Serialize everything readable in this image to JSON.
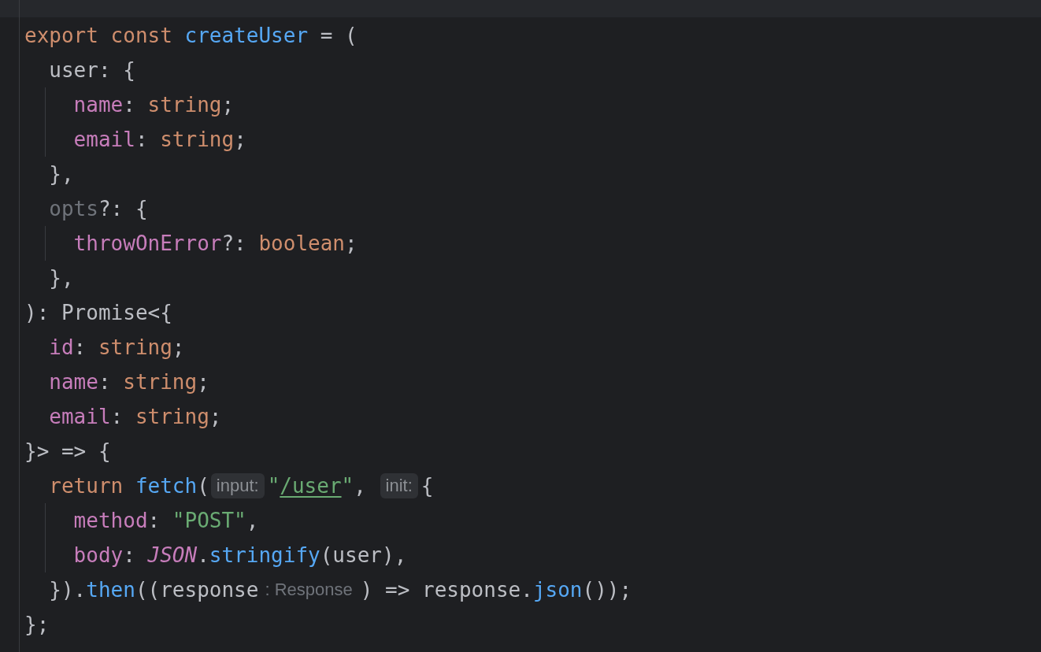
{
  "editor": {
    "lines": [
      {
        "tokens": [
          {
            "kind": "keyword",
            "text": "export const "
          },
          {
            "kind": "function",
            "text": "createUser"
          },
          {
            "kind": "plain",
            "text": " = ("
          }
        ],
        "children": [
          {
            "tokens": [
              {
                "kind": "plain",
                "text": "user: {"
              }
            ],
            "children": [
              {
                "tokens": [
                  {
                    "kind": "property",
                    "text": "name"
                  },
                  {
                    "kind": "plain",
                    "text": ": "
                  },
                  {
                    "kind": "type",
                    "text": "string"
                  },
                  {
                    "kind": "plain",
                    "text": ";"
                  }
                ]
              },
              {
                "tokens": [
                  {
                    "kind": "property",
                    "text": "email"
                  },
                  {
                    "kind": "plain",
                    "text": ": "
                  },
                  {
                    "kind": "type",
                    "text": "string"
                  },
                  {
                    "kind": "plain",
                    "text": ";"
                  }
                ]
              }
            ]
          },
          {
            "tokens": [
              {
                "kind": "plain",
                "text": "},"
              }
            ]
          },
          {
            "tokens": [
              {
                "kind": "unused",
                "text": "opts"
              },
              {
                "kind": "plain",
                "text": "?: {"
              }
            ],
            "children": [
              {
                "tokens": [
                  {
                    "kind": "property",
                    "text": "throwOnError"
                  },
                  {
                    "kind": "plain",
                    "text": "?: "
                  },
                  {
                    "kind": "type",
                    "text": "boolean"
                  },
                  {
                    "kind": "plain",
                    "text": ";"
                  }
                ]
              }
            ]
          },
          {
            "tokens": [
              {
                "kind": "plain",
                "text": "},"
              }
            ]
          }
        ]
      },
      {
        "tokens": [
          {
            "kind": "plain",
            "text": "): Promise<{"
          }
        ],
        "children": [
          {
            "tokens": [
              {
                "kind": "property",
                "text": "id"
              },
              {
                "kind": "plain",
                "text": ": "
              },
              {
                "kind": "type",
                "text": "string"
              },
              {
                "kind": "plain",
                "text": ";"
              }
            ]
          },
          {
            "tokens": [
              {
                "kind": "property",
                "text": "name"
              },
              {
                "kind": "plain",
                "text": ": "
              },
              {
                "kind": "type",
                "text": "string"
              },
              {
                "kind": "plain",
                "text": ";"
              }
            ]
          },
          {
            "tokens": [
              {
                "kind": "property",
                "text": "email"
              },
              {
                "kind": "plain",
                "text": ": "
              },
              {
                "kind": "type",
                "text": "string"
              },
              {
                "kind": "plain",
                "text": ";"
              }
            ]
          }
        ]
      },
      {
        "tokens": [
          {
            "kind": "plain",
            "text": "}> => {"
          }
        ],
        "children": [
          {
            "tokens": [
              {
                "kind": "keyword",
                "text": "return "
              },
              {
                "kind": "function",
                "text": "fetch"
              },
              {
                "kind": "plain",
                "text": "("
              },
              {
                "kind": "hint",
                "text": "input:"
              },
              {
                "kind": "string",
                "text": "\""
              },
              {
                "kind": "link",
                "text": "/user"
              },
              {
                "kind": "string",
                "text": "\""
              },
              {
                "kind": "plain",
                "text": ", "
              },
              {
                "kind": "hint",
                "text": "init:"
              },
              {
                "kind": "plain",
                "text": "{"
              }
            ],
            "children": [
              {
                "tokens": [
                  {
                    "kind": "property",
                    "text": "method"
                  },
                  {
                    "kind": "plain",
                    "text": ": "
                  },
                  {
                    "kind": "string",
                    "text": "\"POST\""
                  },
                  {
                    "kind": "plain",
                    "text": ","
                  }
                ]
              },
              {
                "tokens": [
                  {
                    "kind": "property",
                    "text": "body"
                  },
                  {
                    "kind": "plain",
                    "text": ": "
                  },
                  {
                    "kind": "static",
                    "text": "JSON"
                  },
                  {
                    "kind": "plain",
                    "text": "."
                  },
                  {
                    "kind": "function",
                    "text": "stringify"
                  },
                  {
                    "kind": "plain",
                    "text": "(user),"
                  }
                ]
              }
            ]
          },
          {
            "tokens": [
              {
                "kind": "plain",
                "text": "})."
              },
              {
                "kind": "function",
                "text": "then"
              },
              {
                "kind": "plain",
                "text": "((response"
              },
              {
                "kind": "type_hint",
                "text": ": Response"
              },
              {
                "kind": "plain",
                "text": ") => response."
              },
              {
                "kind": "function",
                "text": "json"
              },
              {
                "kind": "plain",
                "text": "());"
              }
            ]
          }
        ]
      },
      {
        "tokens": [
          {
            "kind": "plain",
            "text": "};"
          }
        ]
      }
    ]
  }
}
